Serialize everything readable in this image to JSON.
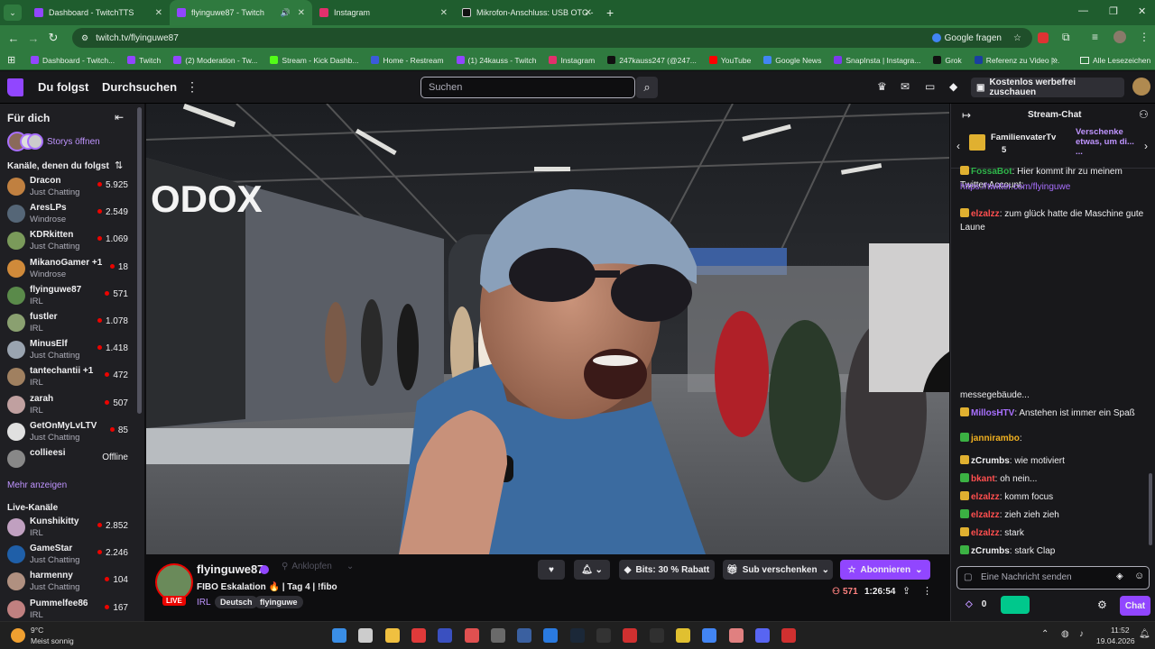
{
  "browser": {
    "tabs": [
      {
        "label": "Dashboard - TwitchTTS",
        "color": "#9146ff"
      },
      {
        "label": "flyinguwe87 - Twitch",
        "color": "#9146ff"
      },
      {
        "label": "Instagram",
        "color": "#e1306c"
      },
      {
        "label": "Mikrofon-Anschluss: USB OTG -",
        "color": "#111111"
      }
    ],
    "url": "twitch.tv/flyinguwe87",
    "google_label": "Google fragen",
    "bookmarks": [
      {
        "label": "Dashboard - Twitch...",
        "color": "#9146ff"
      },
      {
        "label": "Twitch",
        "color": "#9146ff"
      },
      {
        "label": "(2) Moderation - Tw...",
        "color": "#9146ff"
      },
      {
        "label": "Stream - Kick Dashb...",
        "color": "#53fc18"
      },
      {
        "label": "Home - Restream",
        "color": "#3b5bdb"
      },
      {
        "label": "(1) 24kauss - Twitch",
        "color": "#9146ff"
      },
      {
        "label": "Instagram",
        "color": "#e1306c"
      },
      {
        "label": "247kauss247 (@247...",
        "color": "#111111"
      },
      {
        "label": "YouTube",
        "color": "#ff0000"
      },
      {
        "label": "Google News",
        "color": "#4285f4"
      },
      {
        "label": "SnapInsta | Instagra...",
        "color": "#7c3aed"
      },
      {
        "label": "Grok",
        "color": "#111111"
      },
      {
        "label": "Referenz zu Video |...",
        "color": "#1a3fa0"
      }
    ],
    "all_bookmarks": "Alle Lesezeichen"
  },
  "nav": {
    "following": "Du folgst",
    "browse": "Durchsuchen",
    "search_placeholder": "Suchen",
    "adfree": "Kostenlos werbefrei zuschauen"
  },
  "sidebar": {
    "for_you": "Für dich",
    "stories": "Storys öffnen",
    "followed_header": "Kanäle, denen du folgst",
    "followed": [
      {
        "name": "Dracon",
        "game": "Just Chatting",
        "viewers": "5.925",
        "color": "#c08040"
      },
      {
        "name": "AresLPs",
        "game": "Windrose",
        "viewers": "2.549",
        "color": "#556677"
      },
      {
        "name": "KDRkitten",
        "game": "Just Chatting",
        "viewers": "1.069",
        "color": "#7a9a5a"
      },
      {
        "name": "MikanoGamer +1",
        "game": "Windrose",
        "viewers": "18",
        "color": "#d08a3a"
      },
      {
        "name": "flyinguwe87",
        "game": "IRL",
        "viewers": "571",
        "color": "#5a8a4a"
      },
      {
        "name": "fustler",
        "game": "IRL",
        "viewers": "1.078",
        "color": "#8aa070"
      },
      {
        "name": "MinusElf",
        "game": "Just Chatting",
        "viewers": "1.418",
        "color": "#9aa4b0"
      },
      {
        "name": "tantechantii +1",
        "game": "IRL",
        "viewers": "472",
        "color": "#a08060"
      },
      {
        "name": "zarah",
        "game": "IRL",
        "viewers": "507",
        "color": "#c0a0a0"
      },
      {
        "name": "GetOnMyLvLTV",
        "game": "Just Chatting",
        "viewers": "85",
        "color": "#e0e0e0"
      },
      {
        "name": "collieesi",
        "game": "",
        "viewers": "Offline",
        "color": "#888888"
      }
    ],
    "show_more": "Mehr anzeigen",
    "live_header": "Live-Kanäle",
    "live": [
      {
        "name": "Kunshikitty",
        "game": "IRL",
        "viewers": "2.852",
        "color": "#c0a0c0"
      },
      {
        "name": "GameStar",
        "game": "Just Chatting",
        "viewers": "2.246",
        "color": "#1f5fa8"
      },
      {
        "name": "harmenny",
        "game": "Just Chatting",
        "viewers": "104",
        "color": "#b09080"
      },
      {
        "name": "Pummelfee86",
        "game": "IRL",
        "viewers": "167",
        "color": "#c08080"
      }
    ]
  },
  "stream": {
    "channel": "flyinguwe87",
    "knock": "Anklopfen",
    "title": "FIBO Eskalation 🔥 | Tag 4 | !fibo",
    "category": "IRL",
    "tags": [
      "Deutsch",
      "flyinguwe"
    ],
    "live_label": "LIVE",
    "bits": "Bits: 30 % Rabatt",
    "gift": "Sub verschenken",
    "subscribe": "Abonnieren",
    "viewers": "571",
    "uptime": "1:26:54",
    "video_text": "ODOX"
  },
  "chat": {
    "header": "Stream-Chat",
    "pinned_user": "FamilienvaterTv",
    "pinned_count": "5",
    "pinned_text": "Verschenke etwas, um di... ...",
    "messages": [
      {
        "user": "FossaBot",
        "text": ": Hier kommt ihr zu meinem Twitter Account:",
        "color": "#2fb44a"
      },
      {
        "user": "",
        "text": "https://twitter.com/flyinguwe",
        "color": "#a970ff"
      },
      {
        "user": "elzalzz",
        "text": ": zum glück hatte die Maschine gute Laune",
        "color": "#ff4f4f"
      },
      {
        "user": "",
        "text": "messegebäude...",
        "color": "#efeff1"
      },
      {
        "user": "MillosHTV",
        "text": ": Anstehen ist immer ein Spaß",
        "color": "#a970ff"
      },
      {
        "user": "jannirambo",
        "text": ":",
        "color": "#f0b020"
      },
      {
        "user": "zCrumbs",
        "text": ": wie motiviert",
        "color": "#efeff1"
      },
      {
        "user": "bkant",
        "text": ": oh nein...",
        "color": "#ff4f4f"
      },
      {
        "user": "elzalzz",
        "text": ": komm focus",
        "color": "#ff4f4f"
      },
      {
        "user": "elzalzz",
        "text": ": zieh zieh zieh",
        "color": "#ff4f4f"
      },
      {
        "user": "elzalzz",
        "text": ": stark",
        "color": "#ff4f4f"
      },
      {
        "user": "zCrumbs",
        "text": ": stark Clap",
        "color": "#efeff1"
      }
    ],
    "input_placeholder": "Eine Nachricht senden",
    "points": "0",
    "chat_button": "Chat"
  },
  "taskbar": {
    "weather_temp": "9°C",
    "weather_text": "Meist sonnig",
    "time": "11:52",
    "date": "19.04.2026"
  }
}
